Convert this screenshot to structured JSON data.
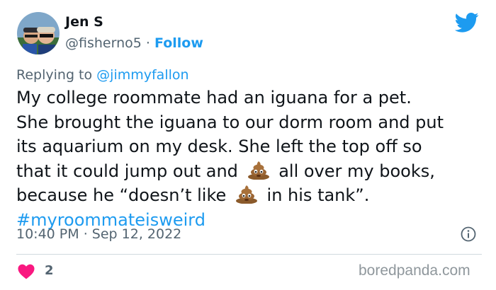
{
  "tweet": {
    "author_name": "Jen S",
    "author_handle": "@fisherno5",
    "separator": "·",
    "follow_label": "Follow",
    "replying_prefix": "Replying to",
    "replying_mention": "@jimmyfallon",
    "lines": {
      "l1": "My college roommate had an iguana for a pet.",
      "l2": "She brought the iguana to our dorm room and put",
      "l3": "its aquarium on my desk.  She left the top off so",
      "l4a": "that it could jump out and",
      "l4b": "all over my books,",
      "l5a": "because he “doesn’t like",
      "l5b": "in his tank”."
    },
    "hashtag": "#myroommateisweird",
    "emoji_name": "pile-of-poo-emoji",
    "time": "10:40 PM",
    "date": "Sep 12, 2022",
    "like_count": "2"
  },
  "icons": {
    "brand": "twitter-bird-icon",
    "info": "info-icon",
    "like": "heart-icon"
  },
  "colors": {
    "link_blue": "#1d9bf0",
    "secondary_text": "#536471",
    "heart_pink": "#f91880",
    "emoji_brown": "#8b5a2b"
  },
  "watermark": "boredpanda.com"
}
